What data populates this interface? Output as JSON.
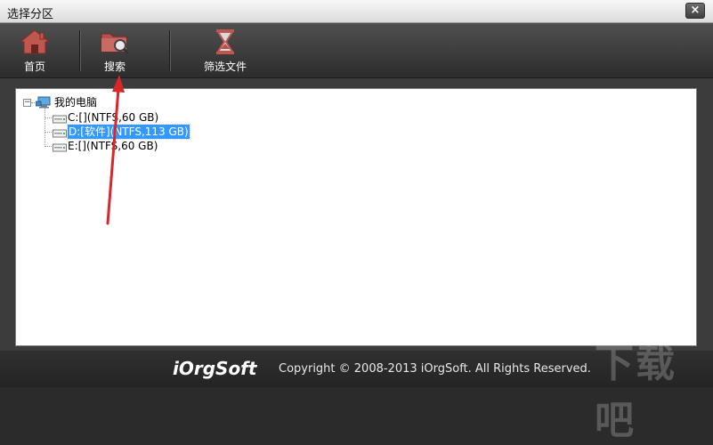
{
  "window": {
    "title": "选择分区",
    "close_label": "×"
  },
  "toolbar": {
    "items": [
      {
        "label": "首页",
        "icon": "home-icon"
      },
      {
        "label": "搜索",
        "icon": "folder-search-icon"
      },
      {
        "label": "筛选文件",
        "icon": "hourglass-icon"
      }
    ]
  },
  "tree": {
    "root": {
      "label": "我的电脑",
      "icon": "computer-icon",
      "expander": "−"
    },
    "drives": [
      {
        "label": "C:[](NTFS,60 GB)",
        "icon": "drive-icon",
        "selected": false
      },
      {
        "label": "D:[软件](NTFS,113 GB)",
        "icon": "drive-icon",
        "selected": true
      },
      {
        "label": "E:[](NTFS,60 GB)",
        "icon": "drive-icon",
        "selected": false
      }
    ]
  },
  "footer": {
    "brand": "iOrgSoft",
    "copyright": "Copyright © 2008-2013 iOrgSoft. All Rights Reserved."
  },
  "watermark": {
    "text": "下载吧"
  },
  "colors": {
    "selection": "#3399ff",
    "toolbar_bg": "#3a3a3a",
    "icon_red": "#b5514b",
    "annotation_arrow": "#d8272b"
  }
}
